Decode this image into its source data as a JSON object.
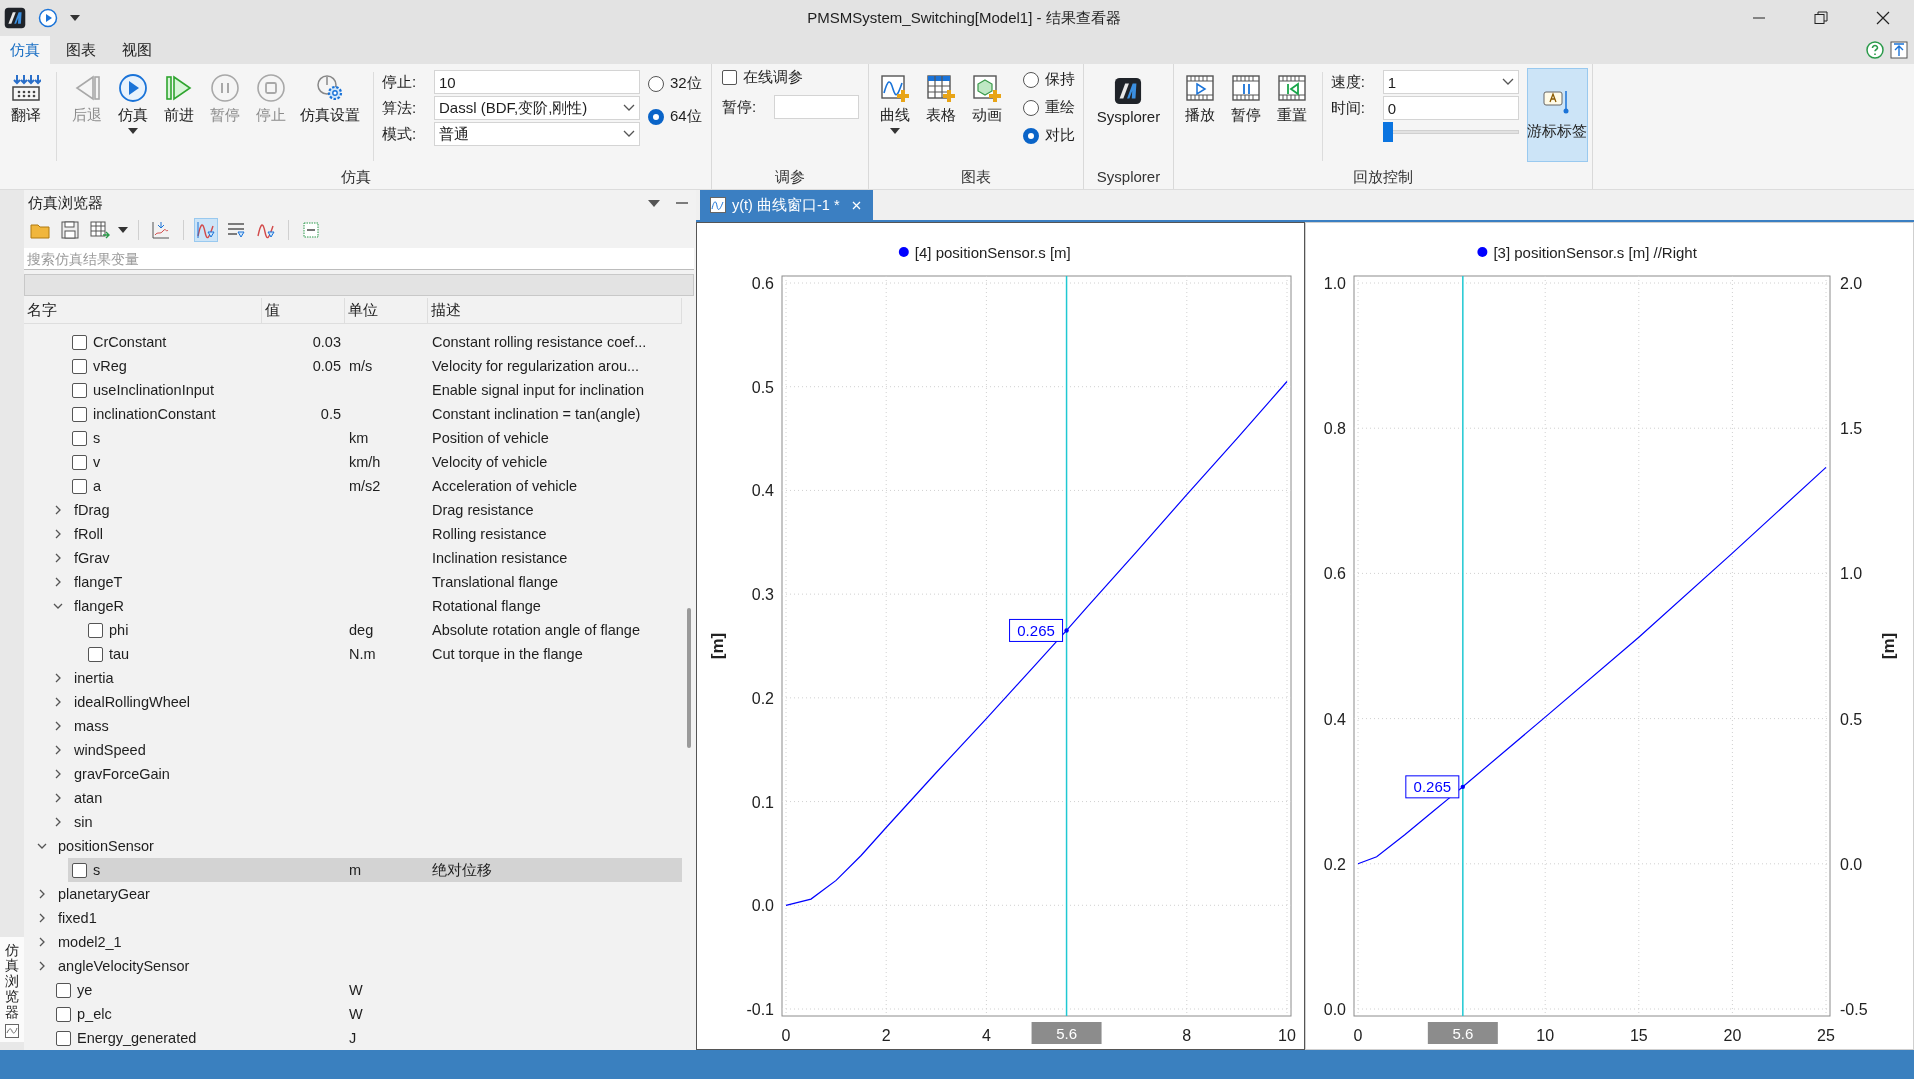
{
  "window": {
    "title": "PMSMSystem_Switching[Model1] - 结果查看器"
  },
  "menu_tabs": [
    {
      "label": "仿真",
      "selected": true
    },
    {
      "label": "图表",
      "selected": false
    },
    {
      "label": "视图",
      "selected": false
    }
  ],
  "ribbon": {
    "simulation": {
      "label": "仿真",
      "buttons": [
        {
          "kind": "translate",
          "label": "翻译",
          "disabled": false
        },
        {
          "kind": "back",
          "label": "后退",
          "disabled": true
        },
        {
          "kind": "run",
          "label": "仿真",
          "disabled": false,
          "dropdown": true
        },
        {
          "kind": "forward",
          "label": "前进",
          "disabled": false
        },
        {
          "kind": "pause",
          "label": "暂停",
          "disabled": true
        },
        {
          "kind": "stop",
          "label": "停止",
          "disabled": true
        },
        {
          "kind": "settings",
          "label": "仿真设置",
          "disabled": false
        }
      ],
      "fields": [
        {
          "label": "停止:",
          "value": "10",
          "kind": "text"
        },
        {
          "label": "算法:",
          "value": "Dassl (BDF,变阶,刚性)",
          "kind": "dropdown"
        },
        {
          "label": "模式:",
          "value": "普通",
          "kind": "dropdown"
        }
      ],
      "precision": [
        {
          "label": "32位",
          "selected": false
        },
        {
          "label": "64位",
          "selected": true
        }
      ]
    },
    "tuning": {
      "label": "调参",
      "online": {
        "label": "在线调参",
        "checked": false
      },
      "pause_label": "暂停:"
    },
    "charts": {
      "label": "图表",
      "buttons": [
        {
          "kind": "curve",
          "label": "曲线",
          "dropdown": true
        },
        {
          "kind": "table",
          "label": "表格"
        },
        {
          "kind": "animation",
          "label": "动画"
        }
      ],
      "modes": [
        {
          "label": "保持",
          "selected": false
        },
        {
          "label": "重绘",
          "selected": false
        },
        {
          "label": "对比",
          "selected": true
        }
      ]
    },
    "sysplorer": {
      "label": "Sysplorer",
      "button": "Sysplorer"
    },
    "playback": {
      "label": "回放控制",
      "buttons": [
        {
          "kind": "play",
          "label": "播放"
        },
        {
          "kind": "pause",
          "label": "暂停"
        },
        {
          "kind": "reset",
          "label": "重置"
        }
      ],
      "speed": {
        "label": "速度:",
        "value": "1"
      },
      "time": {
        "label": "时间:",
        "value": "0",
        "level": 0
      },
      "cursor_button": {
        "label": "游标标签",
        "selected": true
      }
    }
  },
  "side_tab": {
    "label": "仿真浏览器"
  },
  "browser": {
    "title": "仿真浏览器",
    "search": {
      "placeholder": "搜索仿真结果变量"
    },
    "columns": [
      "名字",
      "值",
      "单位",
      "描述"
    ],
    "continued_rows": [
      {
        "kind": "variable",
        "name": "CrConstant",
        "value": "0.03",
        "description": "Constant rolling resistance coef...",
        "checked": false,
        "selected": false
      },
      {
        "kind": "variable",
        "name": "vReg",
        "value": "0.05",
        "unit": "m/s",
        "description": "Velocity for regularization arou...",
        "checked": false,
        "selected": false
      },
      {
        "kind": "variable",
        "name": "useInclinationInput",
        "description": "Enable signal input for inclination",
        "checked": false,
        "selected": false
      },
      {
        "kind": "variable",
        "name": "inclinationConstant",
        "value": "0.5",
        "description": "Constant inclination = tan(angle)",
        "checked": false,
        "selected": false
      },
      {
        "kind": "variable",
        "name": "s",
        "unit": "km",
        "description": "Position of vehicle",
        "checked": false,
        "selected": false
      },
      {
        "kind": "variable",
        "name": "v",
        "unit": "km/h",
        "description": "Velocity of vehicle",
        "checked": false,
        "selected": false
      },
      {
        "kind": "variable",
        "name": "a",
        "unit": "m/s2",
        "description": "Acceleration of vehicle",
        "checked": false,
        "selected": false
      },
      {
        "kind": "group",
        "name": "fDrag",
        "description": "Drag resistance",
        "expanded": false,
        "selected": false
      },
      {
        "kind": "group",
        "name": "fRoll",
        "description": "Rolling resistance",
        "expanded": false,
        "selected": false
      },
      {
        "kind": "group",
        "name": "fGrav",
        "description": "Inclination resistance",
        "expanded": false,
        "selected": false
      },
      {
        "kind": "group",
        "name": "flangeT",
        "description": "Translational flange",
        "expanded": false,
        "selected": false
      },
      {
        "kind": "group",
        "name": "flangeR",
        "description": "Rotational flange",
        "expanded": true,
        "selected": false,
        "children": [
          {
            "kind": "variable",
            "name": "phi",
            "unit": "deg",
            "description": "Absolute rotation angle of flange",
            "checked": false,
            "selected": false
          },
          {
            "kind": "variable",
            "name": "tau",
            "unit": "N.m",
            "description": "Cut torque in the flange",
            "checked": false,
            "selected": false
          }
        ]
      },
      {
        "kind": "group",
        "name": "inertia",
        "expanded": false,
        "selected": false
      },
      {
        "kind": "group",
        "name": "idealRollingWheel",
        "expanded": false,
        "selected": false
      },
      {
        "kind": "group",
        "name": "mass",
        "expanded": false,
        "selected": false
      },
      {
        "kind": "group",
        "name": "windSpeed",
        "expanded": false,
        "selected": false
      },
      {
        "kind": "group",
        "name": "gravForceGain",
        "expanded": false,
        "selected": false
      },
      {
        "kind": "group",
        "name": "atan",
        "expanded": false,
        "selected": false
      },
      {
        "kind": "group",
        "name": "sin",
        "expanded": false,
        "selected": false
      }
    ],
    "rows": [
      {
        "kind": "group",
        "name": "positionSensor",
        "expanded": true,
        "selected": false,
        "children": [
          {
            "kind": "variable",
            "name": "s",
            "unit": "m",
            "description": "绝对位移",
            "checked": false,
            "selected": true
          }
        ]
      },
      {
        "kind": "group",
        "name": "planetaryGear",
        "expanded": false,
        "selected": false
      },
      {
        "kind": "group",
        "name": "fixed1",
        "expanded": false,
        "selected": false
      },
      {
        "kind": "group",
        "name": "model2_1",
        "expanded": false,
        "selected": false
      },
      {
        "kind": "group",
        "name": "angleVelocitySensor",
        "expanded": false,
        "selected": false
      },
      {
        "kind": "variable",
        "name": "ye",
        "unit": "W",
        "checked": false,
        "selected": false
      },
      {
        "kind": "variable",
        "name": "p_elc",
        "unit": "W",
        "checked": false,
        "selected": false
      },
      {
        "kind": "variable",
        "name": "Energy_generated",
        "unit": "J",
        "checked": false,
        "selected": false
      }
    ]
  },
  "chart_window": {
    "tab": {
      "label": "y(t) 曲线窗口-1 *",
      "selected": true
    },
    "plots": [
      {
        "chart_data": {
          "type": "line",
          "ylabel": "[m]",
          "x": [
            0,
            0.5,
            1,
            1.5,
            2,
            3,
            4,
            5,
            5.6,
            6,
            7,
            8,
            9,
            10
          ],
          "xlim": [
            0,
            10
          ],
          "ylim": [
            -0.1,
            0.6
          ],
          "xticks": [
            0,
            2,
            4,
            8,
            10
          ],
          "yticks": [
            {
              "value": -0.1,
              "label": "-0.1"
            },
            {
              "value": 0,
              "label": "0.0"
            },
            {
              "value": 0.1,
              "label": "0.1"
            },
            {
              "value": 0.2,
              "label": "0.2"
            },
            {
              "value": 0.3,
              "label": "0.3"
            },
            {
              "value": 0.4,
              "label": "0.4"
            },
            {
              "value": 0.5,
              "label": "0.5"
            },
            {
              "value": 0.6,
              "label": "0.6"
            }
          ],
          "series": [
            {
              "name": "[4] positionSensor.s [m]",
              "color": "#0000ff",
              "values": [
                0,
                0.006,
                0.024,
                0.048,
                0.075,
                0.128,
                0.18,
                0.233,
                0.265,
                0.287,
                0.341,
                0.396,
                0.45,
                0.505
              ]
            }
          ],
          "grid": true,
          "ref_lines": [
            {
              "axis": "x",
              "value": 5.6,
              "label": "5.6"
            }
          ],
          "annotations": [
            {
              "x": 5.6,
              "y": 0.265,
              "text": "0.265"
            }
          ]
        }
      },
      {
        "chart_data": {
          "type": "line",
          "y2label": "[m]",
          "x": [
            0,
            1,
            2.5,
            4,
            5,
            5.6,
            10,
            15,
            20,
            25
          ],
          "xlim": [
            0,
            25
          ],
          "ylim": [
            0,
            1
          ],
          "y2lim": [
            -0.5,
            2
          ],
          "xticks": [
            0,
            10,
            15,
            20,
            25
          ],
          "yticks": [
            {
              "value": 0,
              "label": "0.0"
            },
            {
              "value": 0.2,
              "label": "0.2"
            },
            {
              "value": 0.4,
              "label": "0.4"
            },
            {
              "value": 0.6,
              "label": "0.6"
            },
            {
              "value": 0.8,
              "label": "0.8"
            },
            {
              "value": 1,
              "label": "1.0"
            }
          ],
          "y2ticks": [
            {
              "value": -0.5,
              "label": "-0.5"
            },
            {
              "value": 0,
              "label": "0.0"
            },
            {
              "value": 0.5,
              "label": "0.5"
            },
            {
              "value": 1,
              "label": "1.0"
            },
            {
              "value": 1.5,
              "label": "1.5"
            },
            {
              "value": 2,
              "label": "2.0"
            }
          ],
          "series": [
            {
              "name": "[3] positionSensor.s [m] //Right",
              "color": "#0000ff",
              "axis": "y2",
              "values": [
                0,
                0.024,
                0.1,
                0.18,
                0.233,
                0.265,
                0.505,
                0.78,
                1.07,
                1.365
              ]
            }
          ],
          "grid": true,
          "ref_lines": [
            {
              "axis": "x",
              "value": 5.6,
              "label": "5.6"
            }
          ],
          "annotations": [
            {
              "x": 5.6,
              "y": 0.265,
              "text": "0.265"
            }
          ]
        }
      }
    ]
  }
}
